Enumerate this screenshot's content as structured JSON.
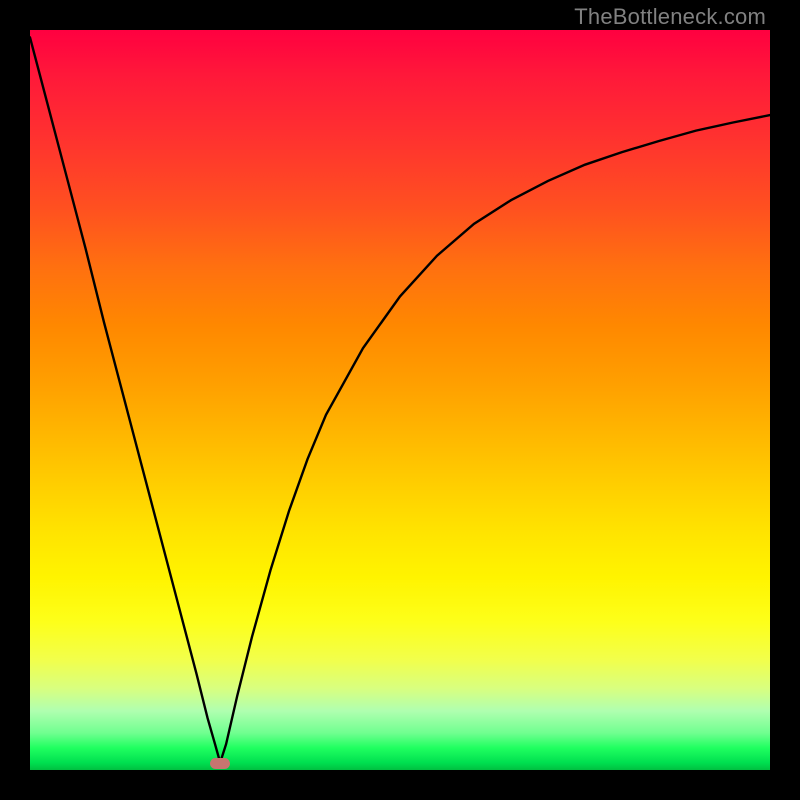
{
  "watermark": "TheBottleneck.com",
  "colors": {
    "background": "#000000",
    "curve": "#000000",
    "marker": "#c77570",
    "watermark": "#818181"
  },
  "chart_data": {
    "type": "line",
    "title": "",
    "xlabel": "",
    "ylabel": "",
    "xlim": [
      0,
      100
    ],
    "ylim": [
      0,
      100
    ],
    "gradient_meaning": "red=bad, green=optimal (bottom)",
    "optimum_marker": {
      "x": 25.7,
      "y": 1.0
    },
    "series": [
      {
        "name": "bottleneck-curve",
        "x": [
          0,
          2.5,
          5,
          7.5,
          10,
          12.5,
          15,
          17.5,
          20,
          22.5,
          24,
          25,
          25.7,
          26.5,
          28,
          30,
          32.5,
          35,
          37.5,
          40,
          45,
          50,
          55,
          60,
          65,
          70,
          75,
          80,
          85,
          90,
          95,
          100
        ],
        "y": [
          99,
          89.5,
          80,
          70.5,
          60.5,
          51,
          41.5,
          32,
          22.5,
          13,
          7,
          3.5,
          1.0,
          3.5,
          10,
          18,
          27,
          35,
          42,
          48,
          57,
          64,
          69.5,
          73.8,
          77,
          79.6,
          81.8,
          83.5,
          85,
          86.4,
          87.5,
          88.5
        ]
      }
    ]
  }
}
